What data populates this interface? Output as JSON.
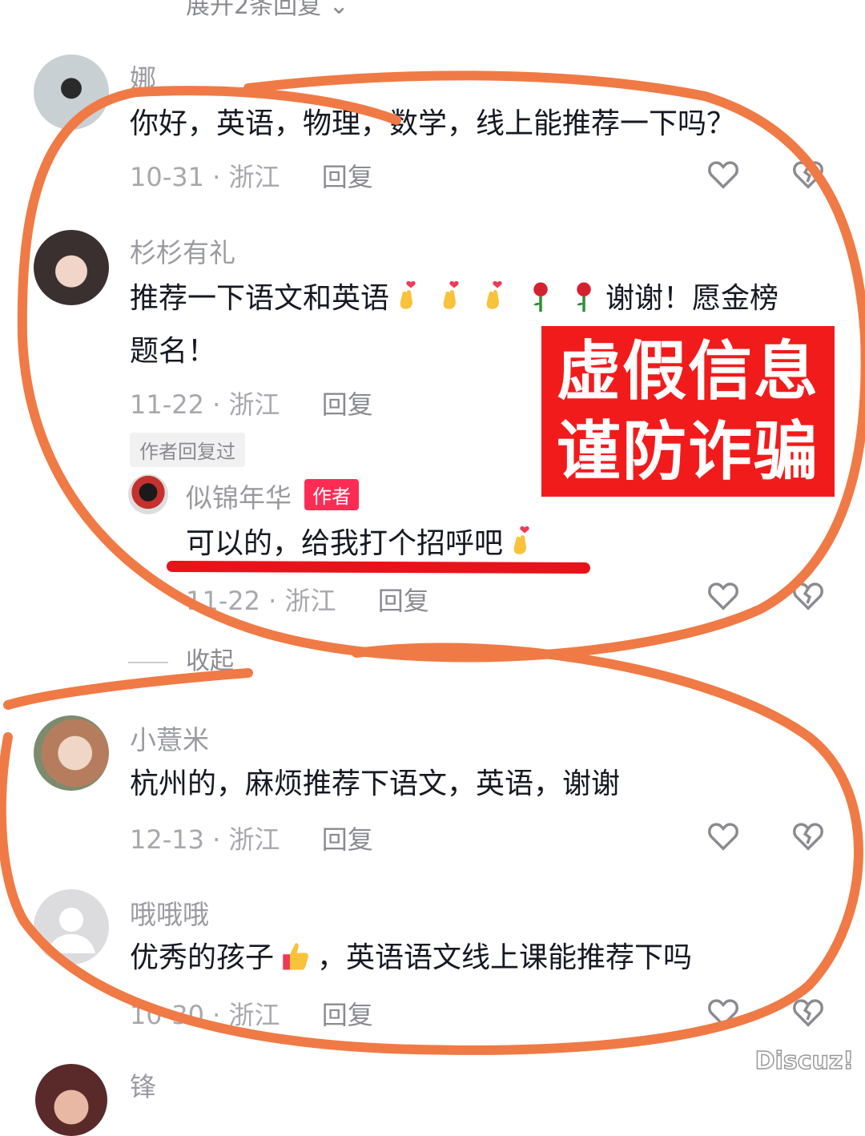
{
  "top_expand": "展开2条回复 ⌄",
  "comments": [
    {
      "user": "娜",
      "text": "你好，英语，物理，数学，线上能推荐一下吗？",
      "date": "10-31",
      "region": "浙江",
      "reply": "回复"
    },
    {
      "user": "杉杉有礼",
      "text_line1": "推荐一下语文和英语",
      "text_suffix": "谢谢！愿金榜",
      "text_line2": "题名！",
      "date": "11-22",
      "region": "浙江",
      "reply": "回复",
      "author_replied": "作者回复过"
    },
    {
      "user": "似锦年华",
      "badge": "作者",
      "text": "可以的，给我打个招呼吧",
      "date": "11-22",
      "region": "浙江",
      "reply": "回复"
    },
    {
      "user": "小薏米",
      "text": "杭州的，麻烦推荐下语文，英语，谢谢",
      "date": "12-13",
      "region": "浙江",
      "reply": "回复"
    },
    {
      "user": "哦哦哦",
      "text_a": "优秀的孩子",
      "text_b": "，英语语文线上课能推荐下吗",
      "date": "10-30",
      "region": "浙江",
      "reply": "回复"
    },
    {
      "user": "锋"
    }
  ],
  "collapse": "收起",
  "banner": {
    "line1": "虚假信息",
    "line2": "谨防诈骗"
  },
  "separator": "·",
  "watermark": "Discuz!",
  "colors": {
    "annotation": "#f07a45",
    "banner": "#f21b1b",
    "underline": "#e8131a",
    "badge": "#fe2c55"
  },
  "icons": [
    "heart-icon",
    "broken-heart-icon",
    "finger-heart-emoji",
    "rose-emoji",
    "thumbs-up-emoji"
  ]
}
